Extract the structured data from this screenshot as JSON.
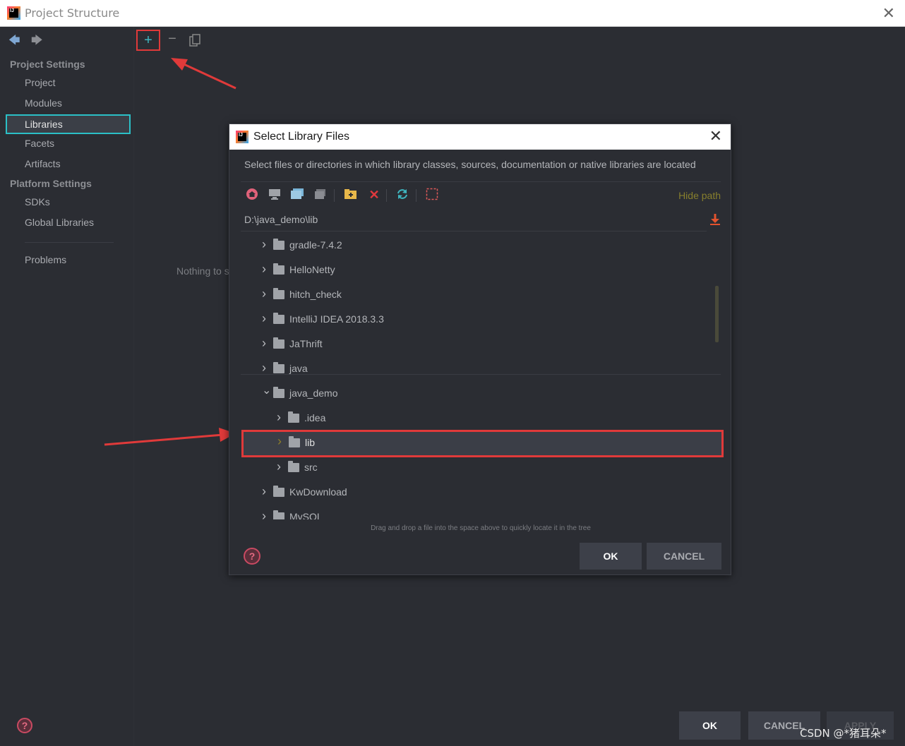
{
  "window": {
    "title": "Project Structure",
    "icon_text": "IJ"
  },
  "sidebar": {
    "project_settings_header": "Project Settings",
    "project_items": [
      {
        "label": "Project"
      },
      {
        "label": "Modules"
      },
      {
        "label": "Libraries",
        "selected": true
      },
      {
        "label": "Facets"
      },
      {
        "label": "Artifacts"
      }
    ],
    "platform_settings_header": "Platform Settings",
    "platform_items": [
      {
        "label": "SDKs"
      },
      {
        "label": "Global Libraries"
      }
    ],
    "problems_label": "Problems"
  },
  "toolbar": {
    "add_symbol": "+",
    "remove_symbol": "−",
    "copy_icon": "copy-icon"
  },
  "main": {
    "empty_text": "Nothing to s"
  },
  "footer": {
    "ok_label": "OK",
    "cancel_label": "CANCEL",
    "apply_label": "APPLY",
    "help_symbol": "?",
    "watermark": "CSDN @*猪耳朵*"
  },
  "dialog": {
    "title": "Select Library Files",
    "icon_text": "IJ",
    "description": "Select files or directories in which library classes, sources, documentation or native libraries are located",
    "hide_path_label": "Hide path",
    "path_value": "D:\\java_demo\\lib",
    "tree": [
      {
        "label": "gradle-7.4.2",
        "depth": 0,
        "expanded": false
      },
      {
        "label": "HelloNetty",
        "depth": 0,
        "expanded": false
      },
      {
        "label": "hitch_check",
        "depth": 0,
        "expanded": false
      },
      {
        "label": "IntelliJ IDEA 2018.3.3",
        "depth": 0,
        "expanded": false
      },
      {
        "label": "JaThrift",
        "depth": 0,
        "expanded": false
      },
      {
        "label": "java",
        "depth": 0,
        "expanded": false
      },
      {
        "label": "java_demo",
        "depth": 0,
        "expanded": true
      },
      {
        "label": ".idea",
        "depth": 1,
        "expanded": false
      },
      {
        "label": "lib",
        "depth": 1,
        "expanded": false,
        "selected": true
      },
      {
        "label": "src",
        "depth": 1,
        "expanded": false
      },
      {
        "label": "KwDownload",
        "depth": 0,
        "expanded": false
      },
      {
        "label": "MySQL",
        "depth": 0,
        "expanded": false
      }
    ],
    "drag_hint": "Drag and drop a file into the space above to quickly locate it in the tree",
    "ok_label": "OK",
    "cancel_label": "CANCEL",
    "help_symbol": "?",
    "toolbar_icons": [
      "home-icon",
      "desktop-icon",
      "project-folder-icon",
      "module-folder-icon",
      "new-folder-icon",
      "delete-icon",
      "refresh-icon",
      "show-hidden-icon"
    ]
  },
  "colors": {
    "background": "#2b2d33",
    "selection_outline": "#2bc0c7",
    "annotation_red": "#e03a3a",
    "hide_path": "#877f2d"
  }
}
